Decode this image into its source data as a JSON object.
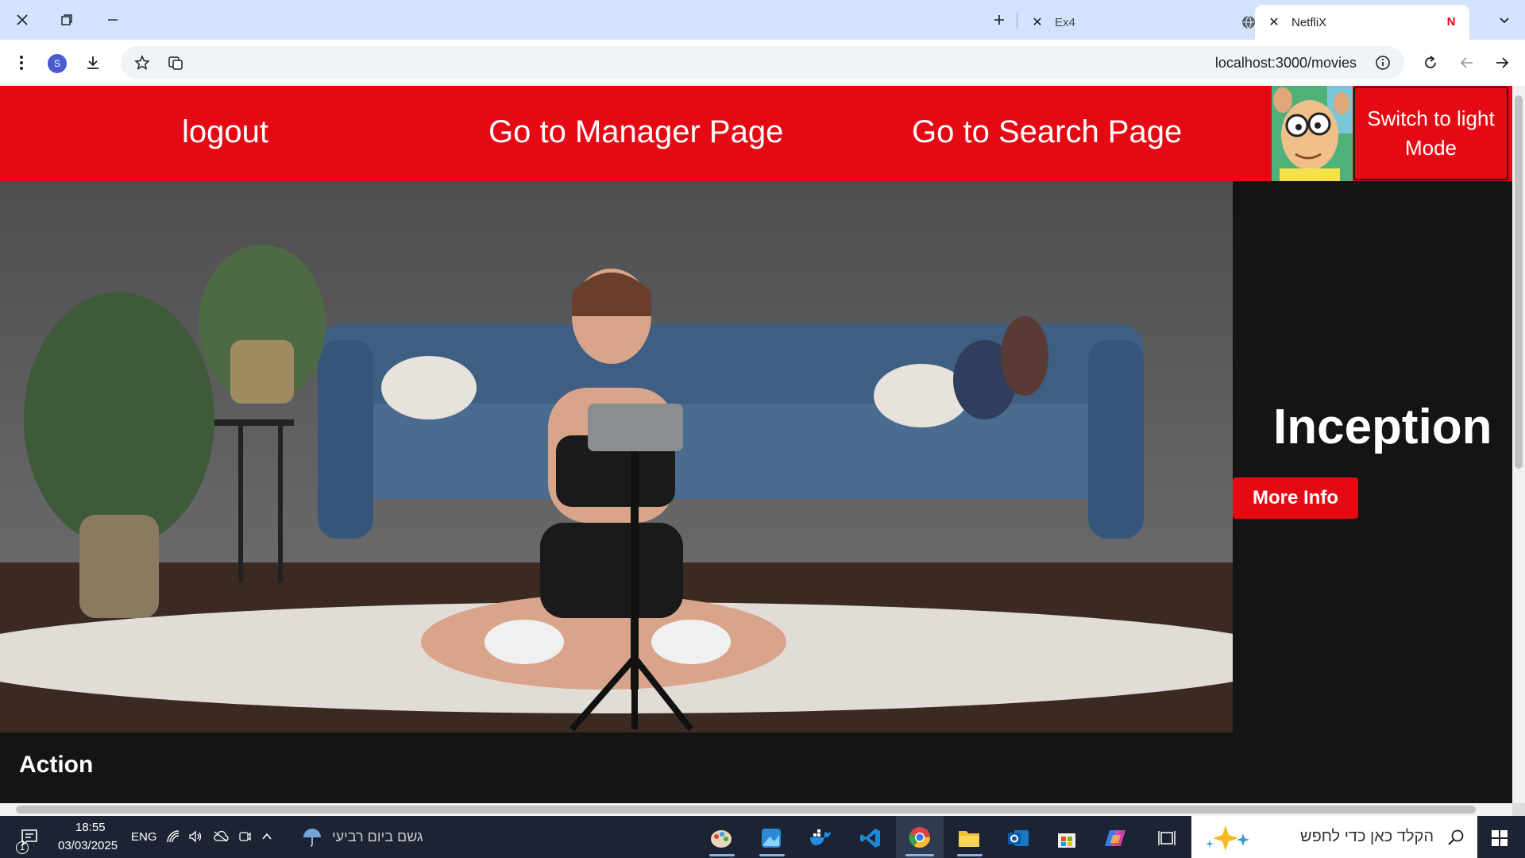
{
  "browser": {
    "tabs": [
      {
        "title": "Ex4",
        "active": false
      },
      {
        "title": "NetfliX",
        "active": true
      }
    ],
    "url": "localhost:3000/movies",
    "profile_initial": "S"
  },
  "navbar": {
    "logout_label": "logout",
    "manager_label": "Go to Manager Page",
    "search_label": "Go to Search Page",
    "mode_button_label": "Switch to light Mode"
  },
  "hero": {
    "title": "Inception",
    "more_info_label": "More Info"
  },
  "sections": [
    {
      "title": "Action"
    }
  ],
  "taskbar": {
    "time": "18:55",
    "date": "03/03/2025",
    "language": "ENG",
    "weather_text": "גשם ביום רביעי",
    "search_placeholder": "הקלד כאן כדי לחפש",
    "notification_count": "1"
  },
  "colors": {
    "brand_red": "#e50914",
    "page_bg": "#141414",
    "chrome_tabbar": "#d3e3fd"
  }
}
